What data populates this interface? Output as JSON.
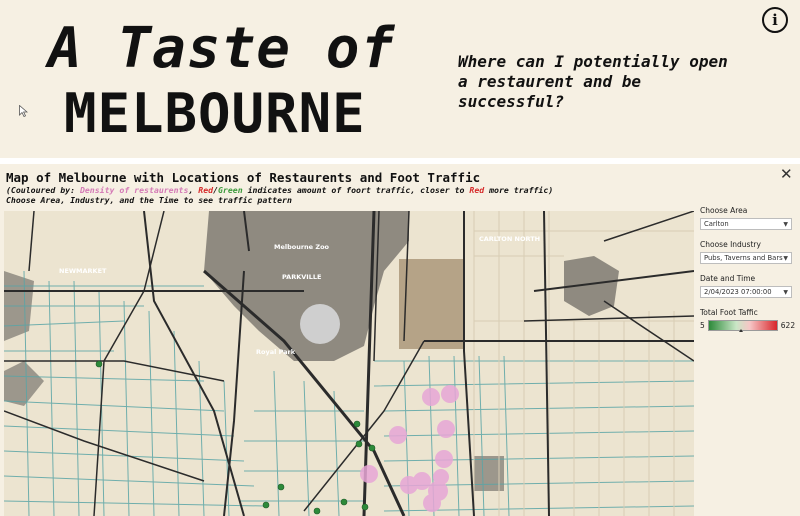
{
  "header": {
    "title_line1": "A Taste of",
    "title_line2": "MELBOURNE",
    "question": "Where can I potentially open a restaurent and be successful?",
    "info_label": "i"
  },
  "viz": {
    "title": "Map of Melbourne with Locations of Restaurents and Foot Traffic",
    "subtitle_prefix": "(Couloured by: ",
    "subtitle_density": "Density of restaurents",
    "subtitle_comma": ", ",
    "subtitle_red": "Red",
    "subtitle_slash": "/",
    "subtitle_green": "Green",
    "subtitle_mid": " indicates amount of foort traffic, closer to ",
    "subtitle_red2": "Red",
    "subtitle_end": " more traffic)",
    "instruction": "Choose Area, Industry, and the Time to see traffic pattern",
    "close_label": "✕"
  },
  "map_labels": {
    "melbourne_zoo": "Melbourne Zoo",
    "carlton_north": "CARLTON NORTH",
    "parkville": "PARKVILLE",
    "newmarket": "NEWMARKET",
    "royal_park": "Royal Park"
  },
  "filters": {
    "area_label": "Choose Area",
    "area_value": "Carlton",
    "industry_label": "Choose Industry",
    "industry_value": "Pubs, Taverns and Bars",
    "datetime_label": "Date and Time",
    "datetime_value": "2/04/2023 07:00:00",
    "traffic_label": "Total Foot Taffic",
    "traffic_min": "5",
    "traffic_max": "622"
  },
  "colors": {
    "background": "#f6f0e3",
    "density_pink": "#e7a6d6",
    "traffic_green": "#2d8a3a",
    "traffic_red": "#d8262b",
    "road_dark": "#2b2b2b",
    "road_teal": "#5aa5a6"
  }
}
